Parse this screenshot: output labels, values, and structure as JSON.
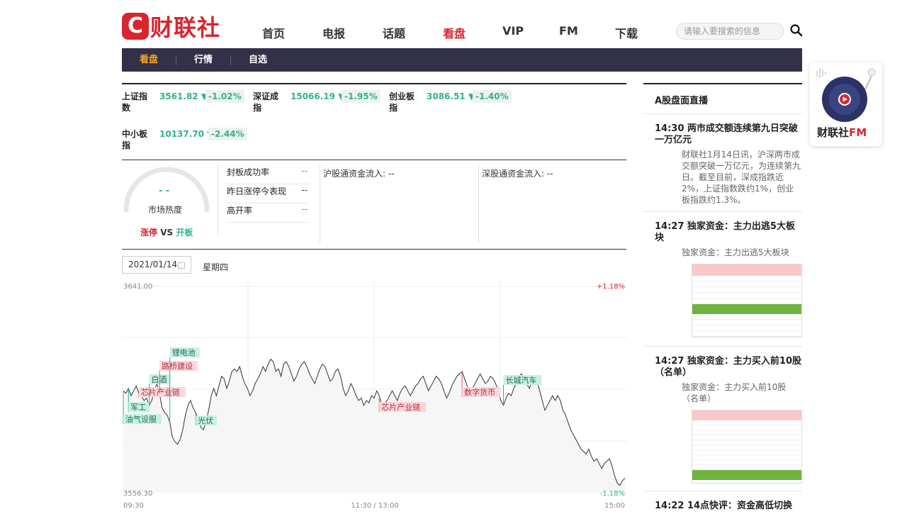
{
  "header": {
    "logo_mark": "C",
    "logo_text": "财联社",
    "nav": [
      "首页",
      "电报",
      "话题",
      "看盘",
      "VIP",
      "FM",
      "下载"
    ],
    "nav_active": "看盘",
    "search_placeholder": "请输入要搜索的信息"
  },
  "subnav": {
    "items": [
      "看盘",
      "行情",
      "自选"
    ],
    "active": "看盘"
  },
  "indices": [
    {
      "name": "上证指数",
      "value": "3561.82 ▼",
      "pct": "-1.02%"
    },
    {
      "name": "深证成指",
      "value": "15066.19 ▼",
      "pct": "-1.95%"
    },
    {
      "name": "创业板指",
      "value": "3086.51 ▼",
      "pct": "-1.40%"
    },
    {
      "name": "中小板指",
      "value": "10137.70 ▼",
      "pct": "-2.44%"
    }
  ],
  "heat": {
    "value": "- -",
    "label": "市场热度",
    "vs_left": "涨停",
    "vs_mid": " VS ",
    "vs_right": "开板"
  },
  "stats": [
    {
      "label": "封板成功率",
      "value": "--"
    },
    {
      "label": "昨日涨停今表现",
      "value": "--"
    },
    {
      "label": "高开率",
      "value": "--"
    }
  ],
  "flows": {
    "sh_label": "沪股通资金流入: --",
    "sz_label": "深股通资金流入: --"
  },
  "date_bar": {
    "date": "2021/01/14",
    "weekday": "星期四"
  },
  "chart_data": {
    "type": "line",
    "y_top_label": "3641.00",
    "y_bottom_label": "3556.30",
    "pct_top": "+1.18%",
    "pct_bottom": "-1.18%",
    "x_labels": [
      "09:30",
      "11:30 / 13:00",
      "15:00"
    ],
    "ylim": [
      3556.3,
      3641.0
    ],
    "values": [
      3598,
      3597,
      3599,
      3596,
      3598,
      3600,
      3597,
      3596,
      3594,
      3595,
      3592,
      3594,
      3598,
      3601,
      3597,
      3591,
      3589,
      3588,
      3585,
      3579,
      3577,
      3576,
      3578,
      3582,
      3588,
      3592,
      3594,
      3591,
      3589,
      3586,
      3583,
      3582,
      3585,
      3590,
      3596,
      3599,
      3596,
      3600,
      3604,
      3603,
      3599,
      3602,
      3606,
      3607,
      3606,
      3608,
      3604,
      3601,
      3599,
      3596,
      3598,
      3601,
      3603,
      3605,
      3608,
      3606,
      3609,
      3611,
      3610,
      3606,
      3607,
      3604,
      3609,
      3610,
      3608,
      3605,
      3602,
      3604,
      3607,
      3609,
      3610,
      3608,
      3605,
      3603,
      3601,
      3604,
      3607,
      3609,
      3608,
      3605,
      3602,
      3603,
      3606,
      3607,
      3604,
      3599,
      3596,
      3598,
      3601,
      3599,
      3596,
      3594,
      3595,
      3592,
      3594,
      3593,
      3596,
      3595,
      3598,
      3596,
      3592,
      3593,
      3594,
      3596,
      3598,
      3596,
      3594,
      3597,
      3599,
      3600,
      3598,
      3596,
      3598,
      3600,
      3601,
      3603,
      3604,
      3601,
      3598,
      3600,
      3602,
      3604,
      3603,
      3601,
      3598,
      3595,
      3597,
      3600,
      3602,
      3604,
      3605,
      3606,
      3603,
      3600,
      3597,
      3599,
      3601,
      3603,
      3605,
      3603,
      3601,
      3602,
      3604,
      3603,
      3601,
      3598,
      3594,
      3592,
      3595,
      3597,
      3596,
      3599,
      3601,
      3604,
      3605,
      3603,
      3601,
      3599,
      3602,
      3604,
      3602,
      3598,
      3594,
      3590,
      3592,
      3594,
      3596,
      3594,
      3596,
      3594,
      3590,
      3588,
      3585,
      3582,
      3580,
      3578,
      3576,
      3574,
      3573,
      3572,
      3574,
      3571,
      3569,
      3570,
      3568,
      3566,
      3568,
      3569,
      3570,
      3567,
      3563,
      3560,
      3559,
      3561,
      3562
    ],
    "tags": [
      {
        "label": "油气设服",
        "idx": 0,
        "kind": "up"
      },
      {
        "label": "军工",
        "idx": 2,
        "kind": "up"
      },
      {
        "label": "芯片产业链",
        "idx": 6,
        "kind": "down"
      },
      {
        "label": "白酒",
        "idx": 10,
        "kind": "up"
      },
      {
        "label": "路桥建设",
        "idx": 14,
        "kind": "down"
      },
      {
        "label": "锂电池",
        "idx": 18,
        "kind": "up"
      },
      {
        "label": "光伏",
        "idx": 28,
        "kind": "up"
      },
      {
        "label": "芯片产业链",
        "idx": 99,
        "kind": "down"
      },
      {
        "label": "数字货币",
        "idx": 131,
        "kind": "down"
      },
      {
        "label": "长城汽车",
        "idx": 147,
        "kind": "up"
      }
    ]
  },
  "news": {
    "section_title": "A股盘面直播",
    "items": [
      {
        "time": "14:30",
        "title": "两市成交额连续第九日突破一万亿元",
        "body": "财联社1月14日讯，沪深两市成交额突破一万亿元，为连续第九日。截至目前，深成指跌近2%，上证指数跌约1%，创业板指跌约1.3%。"
      },
      {
        "time": "14:27",
        "title": "独家资金：主力出逃5大板块",
        "body": "独家资金：主力出逃5大板块"
      },
      {
        "time": "14:27",
        "title": "独家资金：主力买入前10股（名单）",
        "body": "独家资金：主力买入前10股（名单）"
      },
      {
        "time": "14:22",
        "title": "14点快评：资金高低切换"
      }
    ]
  },
  "fm_card": {
    "label": "财联社",
    "suffix": "FM"
  },
  "colors": {
    "brand": "#d9252e",
    "down": "#2fb38a",
    "nav_bg": "#333149",
    "accent": "#f5a623"
  }
}
